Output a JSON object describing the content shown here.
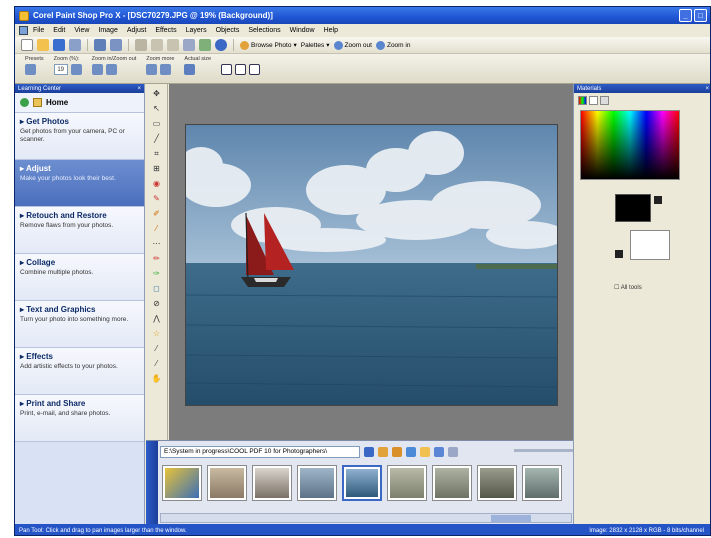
{
  "window": {
    "title": "Corel Paint Shop Pro X - [DSC70279.JPG @ 19% (Background)]"
  },
  "menu": [
    "File",
    "Edit",
    "View",
    "Image",
    "Adjust",
    "Effects",
    "Layers",
    "Objects",
    "Selections",
    "Window",
    "Help"
  ],
  "toolbar": {
    "browse_photo": "Browse Photo",
    "palettes": "Palettes",
    "zoom_out": "Zoom out",
    "zoom_in": "Zoom in"
  },
  "tool_options": {
    "presets": "Presets",
    "zoom_pct": "Zoom (%):",
    "zoom_value": "19",
    "zoom_in_out": "Zoom in/Zoom out",
    "zoom_more": "Zoom more",
    "actual_size": "Actual size"
  },
  "learning_center": {
    "header": "Learning Center",
    "home": "Home",
    "items": [
      {
        "title": "Get Photos",
        "desc": "Get photos from your camera, PC or scanner."
      },
      {
        "title": "Adjust",
        "desc": "Make your photos look their best."
      },
      {
        "title": "Retouch and Restore",
        "desc": "Remove flaws from your photos."
      },
      {
        "title": "Collage",
        "desc": "Combine multiple photos."
      },
      {
        "title": "Text and Graphics",
        "desc": "Turn your photo into something more."
      },
      {
        "title": "Effects",
        "desc": "Add artistic effects to your photos."
      },
      {
        "title": "Print and Share",
        "desc": "Print, e-mail, and share photos."
      }
    ]
  },
  "organizer": {
    "path": "E:\\System in progress\\COOL PDF 10 for Photographers\\"
  },
  "materials": {
    "header": "Materials",
    "all_tools": "All tools"
  },
  "status": {
    "left": "Pan Tool: Click and drag to pan images larger than the window.",
    "right": "Image: 2832 x 2128 x RGB - 8 bits/channel"
  },
  "colors": {
    "title_bar": "#1f55d4",
    "panel_bg": "#d8e2f4",
    "workspace_bg": "#7c7c7c",
    "status_bar": "#2554c7"
  }
}
